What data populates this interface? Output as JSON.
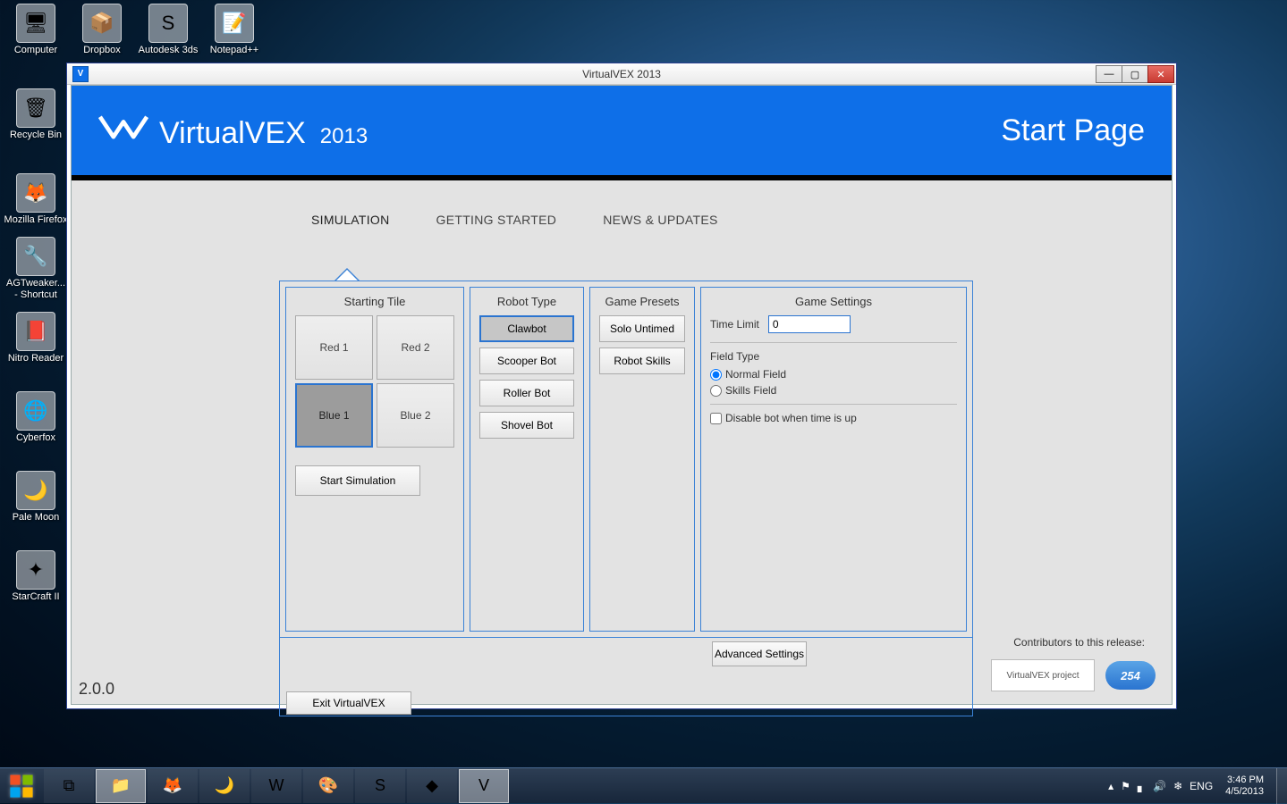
{
  "desktop": {
    "col1": [
      {
        "label": "Computer",
        "glyph": "🖥"
      },
      {
        "label": "Recycle Bin",
        "glyph": "🗑"
      },
      {
        "label": "Mozilla Firefox",
        "glyph": "🦊"
      },
      {
        "label": "AGTweaker... - Shortcut",
        "glyph": "🔧"
      },
      {
        "label": "Nitro Reader",
        "glyph": "📕"
      },
      {
        "label": "Cyberfox",
        "glyph": "🌐"
      },
      {
        "label": "Pale Moon",
        "glyph": "🌙"
      },
      {
        "label": "StarCraft II",
        "glyph": "✦"
      }
    ],
    "col2": [
      {
        "label": "Dropbox",
        "glyph": "📦"
      }
    ],
    "col3": [
      {
        "label": "Autodesk 3ds",
        "glyph": "S"
      }
    ],
    "col4": [
      {
        "label": "Notepad++",
        "glyph": "📝"
      }
    ]
  },
  "window": {
    "title": "VirtualVEX 2013"
  },
  "banner": {
    "brand": "VirtualVEX",
    "year": "2013",
    "page": "Start Page"
  },
  "tabs": [
    "SIMULATION",
    "GETTING STARTED",
    "NEWS & UPDATES"
  ],
  "startingTile": {
    "header": "Starting Tile",
    "tiles": [
      "Red 1",
      "Red 2",
      "Blue 1",
      "Blue 2"
    ],
    "selected": "Blue 1",
    "startBtn": "Start Simulation"
  },
  "robotType": {
    "header": "Robot Type",
    "options": [
      "Clawbot",
      "Scooper Bot",
      "Roller Bot",
      "Shovel Bot"
    ],
    "selected": "Clawbot"
  },
  "gamePresets": {
    "header": "Game Presets",
    "options": [
      "Solo Untimed",
      "Robot Skills"
    ]
  },
  "gameSettings": {
    "header": "Game Settings",
    "timeLimitLabel": "Time Limit",
    "timeLimitValue": "0",
    "fieldTypeLabel": "Field Type",
    "radios": [
      "Normal Field",
      "Skills Field"
    ],
    "radioSelected": "Normal Field",
    "checkbox": "Disable bot when time is up"
  },
  "buttons": {
    "advanced": "Advanced Settings",
    "exit": "Exit VirtualVEX"
  },
  "footer": {
    "version": "2.0.0",
    "contrib": "Contributors to this release:",
    "logo1": "VirtualVEX project",
    "logo2": "254"
  },
  "taskbar": {
    "time": "3:46 PM",
    "date": "4/5/2013",
    "lang": "ENG"
  }
}
